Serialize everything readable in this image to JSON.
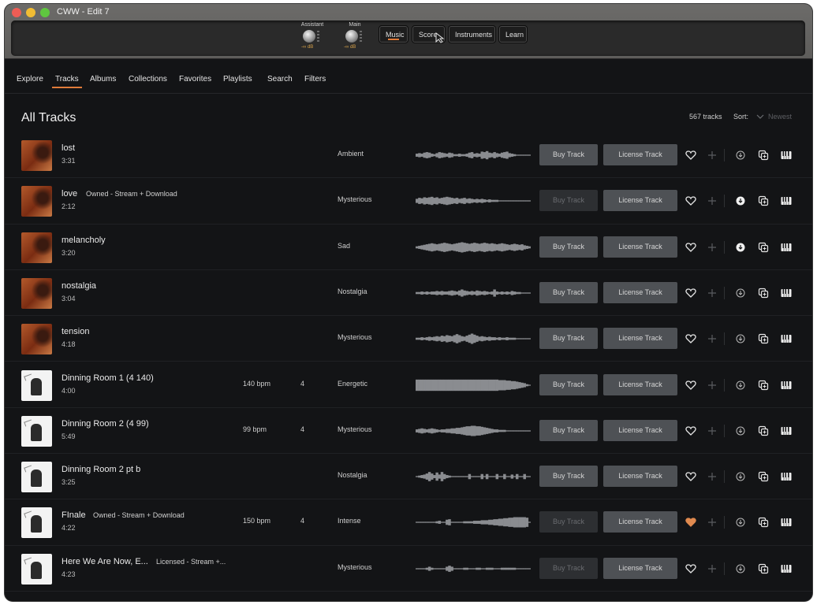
{
  "window": {
    "title": "CWW - Edit 7"
  },
  "toolbar": {
    "meters": [
      {
        "label": "Assistant",
        "db": "-∞ dB"
      },
      {
        "label": "Main",
        "db": "-∞ dB"
      }
    ],
    "buttons": [
      "Music",
      "Score",
      "Instruments",
      "Learn"
    ],
    "active_button": "Music"
  },
  "nav": {
    "tabs": [
      "Explore",
      "Tracks",
      "Albums",
      "Collections",
      "Favorites",
      "Playlists",
      "Search",
      "Filters"
    ],
    "active": "Tracks"
  },
  "page": {
    "heading": "All Tracks",
    "count": "567 tracks",
    "sort_label": "Sort:",
    "sort_value": "Newest"
  },
  "track_actions": {
    "buy": "Buy Track",
    "license": "License Track"
  },
  "colors": {
    "accent": "#e07b3a",
    "button": "#4e5155",
    "button_disabled": "#2d2f32",
    "bg": "#131416"
  },
  "tracks": [
    {
      "title": "lost",
      "duration": "3:31",
      "owned": "",
      "bpm": "",
      "key": "",
      "mood": "Ambient",
      "cover": "red",
      "buy_enabled": true,
      "favorite": false,
      "downloaded": false,
      "wave": [
        3,
        4,
        3,
        5,
        6,
        5,
        3,
        2,
        4,
        6,
        5,
        4,
        3,
        5,
        4,
        2,
        2,
        3,
        2,
        2,
        3,
        5,
        6,
        3,
        4,
        3,
        7,
        6,
        8,
        5,
        4,
        6,
        4,
        3,
        5,
        6,
        7,
        4,
        3,
        2,
        1,
        1,
        1,
        1,
        1,
        1
      ]
    },
    {
      "title": "love",
      "duration": "2:12",
      "owned": "Owned - Stream + Download",
      "bpm": "",
      "key": "",
      "mood": "Mysterious",
      "cover": "red",
      "buy_enabled": false,
      "favorite": false,
      "downloaded": true,
      "wave": [
        4,
        6,
        5,
        7,
        6,
        7,
        8,
        6,
        7,
        5,
        6,
        7,
        8,
        7,
        6,
        5,
        6,
        4,
        5,
        6,
        4,
        5,
        4,
        3,
        4,
        3,
        4,
        3,
        2,
        3,
        2,
        2,
        2,
        1,
        1,
        1,
        1,
        1,
        1,
        1,
        1,
        1,
        1,
        1,
        1,
        1
      ]
    },
    {
      "title": "melancholy",
      "duration": "3:20",
      "owned": "",
      "bpm": "",
      "key": "",
      "mood": "Sad",
      "cover": "red",
      "buy_enabled": true,
      "favorite": false,
      "downloaded": true,
      "wave": [
        2,
        3,
        4,
        5,
        6,
        7,
        8,
        7,
        6,
        7,
        8,
        9,
        8,
        7,
        6,
        7,
        8,
        9,
        10,
        9,
        8,
        7,
        8,
        9,
        8,
        7,
        8,
        9,
        8,
        7,
        8,
        7,
        6,
        7,
        8,
        7,
        6,
        5,
        6,
        7,
        6,
        5,
        6,
        4,
        3,
        2
      ]
    },
    {
      "title": "nostalgia",
      "duration": "3:04",
      "owned": "",
      "bpm": "",
      "key": "",
      "mood": "Nostalgia",
      "cover": "red",
      "buy_enabled": true,
      "favorite": false,
      "downloaded": false,
      "wave": [
        2,
        2,
        3,
        2,
        3,
        2,
        3,
        3,
        4,
        3,
        4,
        3,
        3,
        4,
        5,
        4,
        3,
        5,
        7,
        5,
        4,
        3,
        4,
        3,
        5,
        4,
        3,
        4,
        3,
        2,
        3,
        7,
        3,
        2,
        3,
        2,
        3,
        2,
        4,
        3,
        2,
        2,
        1,
        1,
        1,
        1
      ]
    },
    {
      "title": "tension",
      "duration": "4:18",
      "owned": "",
      "bpm": "",
      "key": "",
      "mood": "Mysterious",
      "cover": "red",
      "buy_enabled": true,
      "favorite": false,
      "downloaded": false,
      "wave": [
        2,
        2,
        3,
        2,
        3,
        4,
        3,
        4,
        5,
        4,
        6,
        5,
        7,
        6,
        5,
        7,
        9,
        7,
        5,
        4,
        6,
        8,
        10,
        8,
        6,
        4,
        5,
        4,
        3,
        4,
        3,
        3,
        2,
        3,
        2,
        2,
        3,
        2,
        2,
        2,
        1,
        1,
        1,
        1,
        1,
        1
      ]
    },
    {
      "title": "Dinning Room 1 (4 140)",
      "duration": "4:00",
      "owned": "",
      "bpm": "140 bpm",
      "key": "4",
      "mood": "Energetic",
      "cover": "white",
      "buy_enabled": true,
      "favorite": false,
      "downloaded": false,
      "wave": [
        11,
        11,
        11,
        11,
        11,
        11,
        11,
        11,
        11,
        11,
        11,
        11,
        11,
        11,
        11,
        11,
        11,
        11,
        11,
        11,
        11,
        11,
        11,
        11,
        11,
        11,
        11,
        11,
        11,
        11,
        11,
        11,
        11,
        10,
        10,
        10,
        9,
        9,
        8,
        8,
        7,
        6,
        5,
        4,
        2,
        1
      ]
    },
    {
      "title": "Dinning Room 2 (4 99)",
      "duration": "5:49",
      "owned": "",
      "bpm": "99 bpm",
      "key": "4",
      "mood": "Mysterious",
      "cover": "white",
      "buy_enabled": true,
      "favorite": false,
      "downloaded": false,
      "wave": [
        3,
        4,
        5,
        4,
        3,
        4,
        5,
        4,
        3,
        2,
        3,
        3,
        4,
        4,
        5,
        5,
        6,
        6,
        7,
        8,
        9,
        9,
        10,
        10,
        9,
        9,
        8,
        7,
        6,
        5,
        4,
        3,
        3,
        2,
        2,
        2,
        1,
        1,
        1,
        1,
        1,
        1,
        1,
        1,
        1,
        1
      ]
    },
    {
      "title": "Dinning Room 2 pt b",
      "duration": "3:25",
      "owned": "",
      "bpm": "",
      "key": "",
      "mood": "Nostalgia",
      "cover": "white",
      "buy_enabled": true,
      "favorite": false,
      "downloaded": false,
      "wave": [
        1,
        2,
        3,
        4,
        6,
        9,
        6,
        3,
        8,
        4,
        9,
        5,
        3,
        2,
        1,
        1,
        1,
        1,
        1,
        1,
        1,
        5,
        1,
        1,
        1,
        1,
        5,
        1,
        5,
        1,
        1,
        1,
        5,
        1,
        1,
        5,
        1,
        1,
        4,
        1,
        5,
        1,
        1,
        5,
        1,
        1
      ]
    },
    {
      "title": "FInale",
      "duration": "4:22",
      "owned": "Owned - Stream + Download",
      "bpm": "150 bpm",
      "key": "4",
      "mood": "Intense",
      "cover": "white",
      "buy_enabled": false,
      "favorite": true,
      "downloaded": false,
      "wave": [
        1,
        1,
        1,
        1,
        1,
        1,
        1,
        1,
        2,
        3,
        1,
        1,
        5,
        6,
        1,
        1,
        1,
        1,
        1,
        2,
        2,
        2,
        2,
        3,
        3,
        3,
        4,
        4,
        4,
        5,
        5,
        6,
        6,
        7,
        7,
        8,
        8,
        9,
        9,
        10,
        10,
        10,
        10,
        10,
        9,
        1
      ]
    },
    {
      "title": "Here We Are Now, E...",
      "duration": "4:23",
      "owned": "Licensed - Stream +...",
      "bpm": "",
      "key": "",
      "mood": "Mysterious",
      "cover": "white",
      "buy_enabled": false,
      "favorite": false,
      "downloaded": false,
      "wave": [
        1,
        1,
        1,
        1,
        2,
        4,
        2,
        1,
        1,
        1,
        1,
        1,
        4,
        6,
        4,
        1,
        1,
        1,
        1,
        2,
        2,
        1,
        1,
        1,
        2,
        2,
        1,
        1,
        2,
        2,
        2,
        1,
        1,
        1,
        2,
        2,
        2,
        2,
        2,
        2,
        1,
        1,
        1,
        1,
        1,
        1
      ]
    }
  ]
}
